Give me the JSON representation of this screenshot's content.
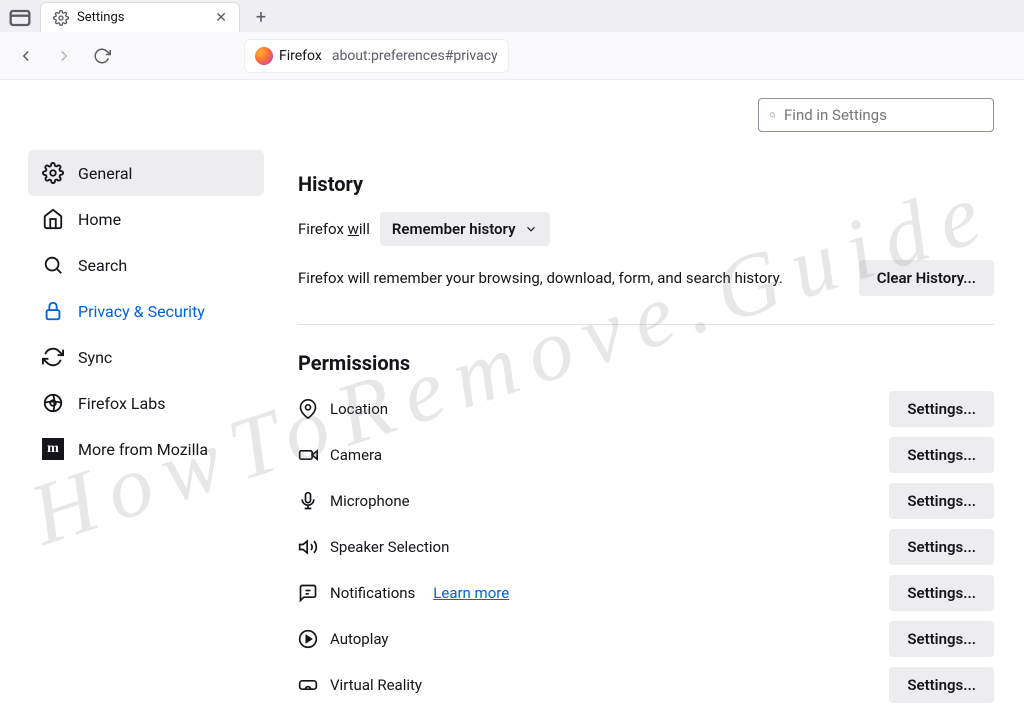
{
  "tab": {
    "title": "Settings"
  },
  "toolbar": {
    "identity": "Firefox",
    "url": "about:preferences#privacy"
  },
  "search": {
    "placeholder": "Find in Settings"
  },
  "sidebar": {
    "items": [
      {
        "label": "General"
      },
      {
        "label": "Home"
      },
      {
        "label": "Search"
      },
      {
        "label": "Privacy & Security"
      },
      {
        "label": "Sync"
      },
      {
        "label": "Firefox Labs"
      },
      {
        "label": "More from Mozilla"
      }
    ]
  },
  "history": {
    "heading": "History",
    "prefix": "Firefox ",
    "will_u": "w",
    "will_rest": "ill",
    "dropdown": "Remember history",
    "desc": "Firefox will remember your browsing, download, form, and search history.",
    "clear_btn": "Clear History..."
  },
  "permissions": {
    "heading": "Permissions",
    "settings_label": "Settings...",
    "learn_more": "Learn more",
    "items": [
      {
        "label": "Location"
      },
      {
        "label": "Camera"
      },
      {
        "label": "Microphone"
      },
      {
        "label": "Speaker Selection"
      },
      {
        "label": "Notifications"
      },
      {
        "label": "Autoplay"
      },
      {
        "label": "Virtual Reality"
      }
    ]
  },
  "watermark": "HowToRemove.Guide"
}
